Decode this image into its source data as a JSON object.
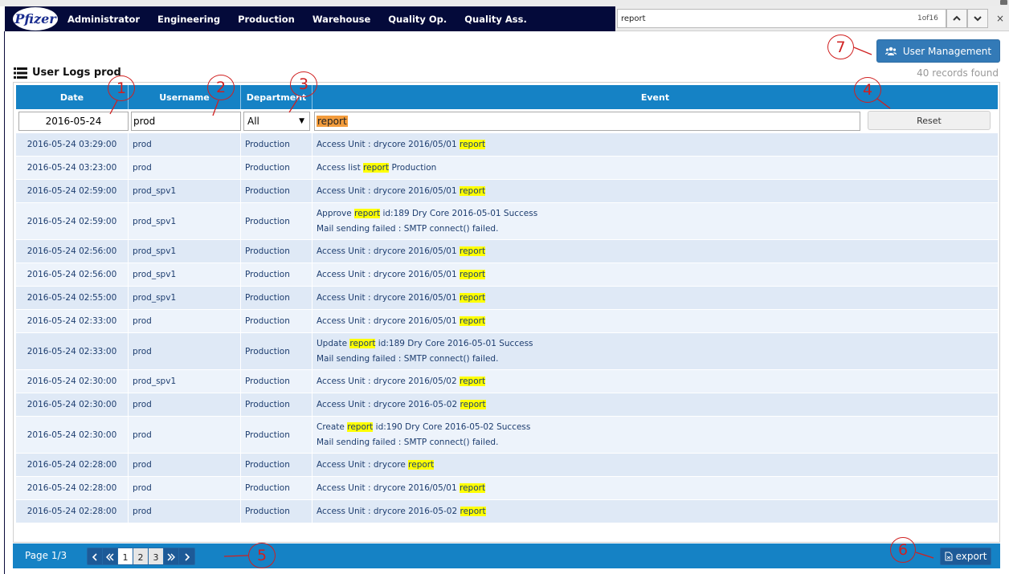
{
  "navbar": {
    "logo_text": "Pfizer",
    "items": [
      "Administrator",
      "Engineering",
      "Production",
      "Warehouse",
      "Quality Op.",
      "Quality Ass."
    ]
  },
  "findbar": {
    "query": "report",
    "count": "1of16",
    "prev_icon": "chevron-up-icon",
    "next_icon": "chevron-down-icon",
    "close": "×"
  },
  "toolbar": {
    "user_management_label": "User Management",
    "user_management_icon": "users-icon"
  },
  "page": {
    "title": "User Logs prod",
    "title_icon": "list-icon",
    "records_found": "40 records found"
  },
  "table": {
    "headers": [
      "Date",
      "Username",
      "Department",
      "Event"
    ],
    "filters": {
      "date": "2016-05-24",
      "username": "prod",
      "department": "All",
      "event": "report",
      "reset_label": "Reset"
    },
    "rows": [
      {
        "date": "2016-05-24 03:29:00",
        "user": "prod",
        "dept": "Production",
        "event": [
          [
            "Access Unit : drycore 2016/05/01 ",
            "report",
            ""
          ]
        ]
      },
      {
        "date": "2016-05-24 03:23:00",
        "user": "prod",
        "dept": "Production",
        "event": [
          [
            "Access list ",
            "report",
            " Production"
          ]
        ]
      },
      {
        "date": "2016-05-24 02:59:00",
        "user": "prod_spv1",
        "dept": "Production",
        "event": [
          [
            "Access Unit : drycore 2016/05/01 ",
            "report",
            ""
          ]
        ]
      },
      {
        "date": "2016-05-24 02:59:00",
        "user": "prod_spv1",
        "dept": "Production",
        "event": [
          [
            "Approve ",
            "report",
            " id:189 Dry Core 2016-05-01 Success"
          ],
          [
            "Mail sending failed : SMTP connect() failed.",
            "",
            ""
          ]
        ]
      },
      {
        "date": "2016-05-24 02:56:00",
        "user": "prod_spv1",
        "dept": "Production",
        "event": [
          [
            "Access Unit : drycore 2016/05/01 ",
            "report",
            ""
          ]
        ]
      },
      {
        "date": "2016-05-24 02:56:00",
        "user": "prod_spv1",
        "dept": "Production",
        "event": [
          [
            "Access Unit : drycore 2016/05/01 ",
            "report",
            ""
          ]
        ]
      },
      {
        "date": "2016-05-24 02:55:00",
        "user": "prod_spv1",
        "dept": "Production",
        "event": [
          [
            "Access Unit : drycore 2016/05/01 ",
            "report",
            ""
          ]
        ]
      },
      {
        "date": "2016-05-24 02:33:00",
        "user": "prod",
        "dept": "Production",
        "event": [
          [
            "Access Unit : drycore 2016/05/01 ",
            "report",
            ""
          ]
        ]
      },
      {
        "date": "2016-05-24 02:33:00",
        "user": "prod",
        "dept": "Production",
        "event": [
          [
            "Update ",
            "report",
            " id:189 Dry Core 2016-05-01 Success"
          ],
          [
            "Mail sending failed : SMTP connect() failed.",
            "",
            ""
          ]
        ]
      },
      {
        "date": "2016-05-24 02:30:00",
        "user": "prod_spv1",
        "dept": "Production",
        "event": [
          [
            "Access Unit : drycore 2016/05/02 ",
            "report",
            ""
          ]
        ]
      },
      {
        "date": "2016-05-24 02:30:00",
        "user": "prod",
        "dept": "Production",
        "event": [
          [
            "Access Unit : drycore 2016-05-02 ",
            "report",
            ""
          ]
        ]
      },
      {
        "date": "2016-05-24 02:30:00",
        "user": "prod",
        "dept": "Production",
        "event": [
          [
            "Create ",
            "report",
            " id:190 Dry Core 2016-05-02 Success"
          ],
          [
            "Mail sending failed : SMTP connect() failed.",
            "",
            ""
          ]
        ]
      },
      {
        "date": "2016-05-24 02:28:00",
        "user": "prod",
        "dept": "Production",
        "event": [
          [
            "Access Unit : drycore ",
            "report",
            ""
          ]
        ]
      },
      {
        "date": "2016-05-24 02:28:00",
        "user": "prod",
        "dept": "Production",
        "event": [
          [
            "Access Unit : drycore 2016/05/01 ",
            "report",
            ""
          ]
        ]
      },
      {
        "date": "2016-05-24 02:28:00",
        "user": "prod",
        "dept": "Production",
        "event": [
          [
            "Access Unit : drycore 2016-05-02 ",
            "report",
            ""
          ]
        ]
      }
    ]
  },
  "footer": {
    "page_info": "Page 1/3",
    "pages": [
      "1",
      "2",
      "3"
    ],
    "current_page": "1",
    "export_label": "export",
    "export_icon": "file-export-icon"
  },
  "annotations": [
    "1",
    "2",
    "3",
    "4",
    "5",
    "6",
    "7"
  ],
  "colors": {
    "navbar": "#040a3a",
    "header_blue": "#1582c5",
    "button_blue": "#337ab7",
    "row_odd": "#dfe9f6",
    "row_even": "#edf3fb",
    "highlight": "#ffff00",
    "active_highlight": "#f39c3c",
    "annotation_red": "#d02020"
  }
}
